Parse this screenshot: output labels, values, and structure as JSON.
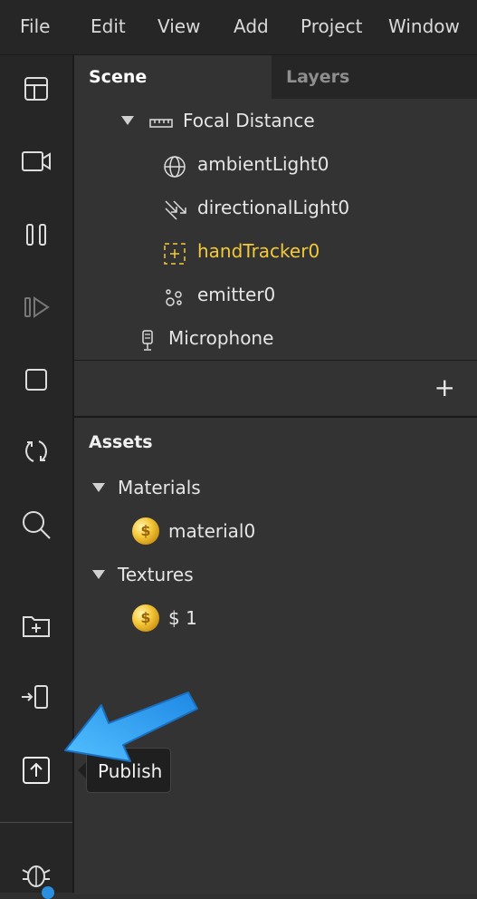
{
  "menubar": {
    "items": [
      {
        "label": "File"
      },
      {
        "label": "Edit"
      },
      {
        "label": "View"
      },
      {
        "label": "Add"
      },
      {
        "label": "Project"
      },
      {
        "label": "Window"
      }
    ]
  },
  "toolbar": {
    "tools": [
      {
        "icon": "layout-icon"
      },
      {
        "icon": "video-camera-icon"
      },
      {
        "icon": "pause-icon"
      },
      {
        "icon": "step-forward-icon"
      },
      {
        "icon": "stop-icon"
      },
      {
        "icon": "refresh-icon"
      },
      {
        "icon": "search-icon"
      },
      {
        "icon": "add-folder-icon"
      },
      {
        "icon": "send-to-device-icon"
      },
      {
        "icon": "publish-icon"
      },
      {
        "icon": "bug-icon"
      }
    ],
    "tooltip": "Publish"
  },
  "scene": {
    "tabs": [
      {
        "label": "Scene",
        "active": true
      },
      {
        "label": "Layers",
        "active": false
      }
    ],
    "tree": [
      {
        "label": "Focal Distance",
        "icon": "ruler-icon",
        "expanded": true
      },
      {
        "label": "ambientLight0",
        "icon": "globe-icon"
      },
      {
        "label": "directionalLight0",
        "icon": "directional-light-icon"
      },
      {
        "label": "handTracker0",
        "icon": "hand-tracker-icon",
        "highlight": "#f3c93a"
      },
      {
        "label": "emitter0",
        "icon": "emitter-icon"
      },
      {
        "label": "Microphone",
        "icon": "microphone-icon"
      }
    ],
    "add_label": "+"
  },
  "assets": {
    "title": "Assets",
    "groups": [
      {
        "label": "Materials",
        "items": [
          {
            "label": "material0",
            "icon": "coin-icon"
          }
        ]
      },
      {
        "label": "Textures",
        "items": [
          {
            "label": "$ 1",
            "icon": "coin-icon"
          }
        ]
      }
    ]
  },
  "colors": {
    "background": "#2f2f2f",
    "panel": "#333333",
    "toolbar": "#262626",
    "highlight": "#f3c93a",
    "arrow": "#3aa7f0"
  }
}
